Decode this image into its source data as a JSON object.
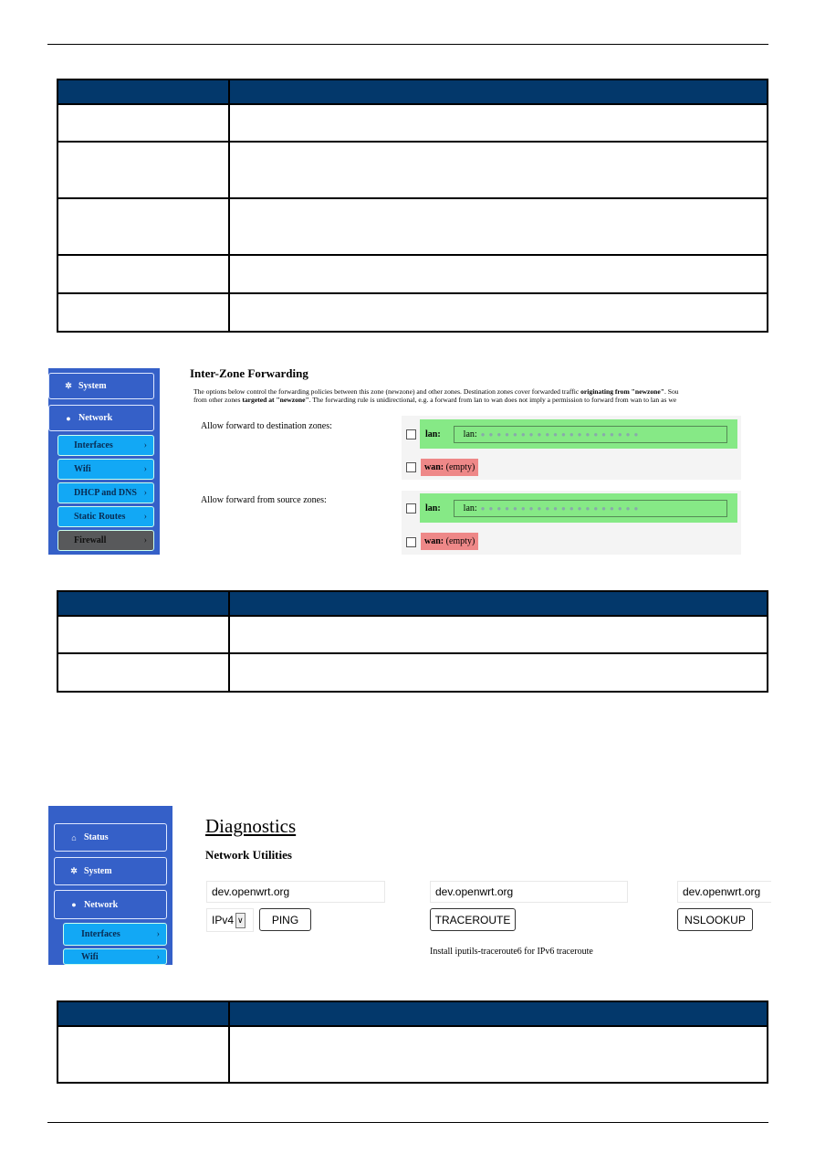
{
  "colors": {
    "table_header": "#03386b",
    "sidebar": "#3560c8",
    "sub_item": "#12a8f5",
    "active_item": "#58595b",
    "zone_lan": "#86e986",
    "zone_wan": "#ee8888"
  },
  "table1": {
    "rows": 5
  },
  "table2": {
    "rows": 2
  },
  "table3": {
    "rows": 1
  },
  "shot1": {
    "sidebar": [
      {
        "label": "System",
        "icon": "gear-icon"
      },
      {
        "label": "Network",
        "icon": "globe-icon"
      }
    ],
    "subitems": [
      "Interfaces",
      "Wifi",
      "DHCP and DNS",
      "Static Routes",
      "Firewall"
    ],
    "chevron": "›",
    "title": "Inter-Zone Forwarding",
    "desc1_a": "The options below control the forwarding policies between this zone (newzone) and other zones. Destination zones cover forwarded traffic ",
    "desc1_b": "originating from \"newzone\"",
    "desc1_c": ". Sou",
    "desc2_a": "from other zones ",
    "desc2_b": "targeted at \"newzone\"",
    "desc2_c": ". The forwarding rule is unidirectional, e.g. a forward from lan to wan does not imply a permission to forward from wan to lan as we",
    "dest_label": "Allow forward to destination zones:",
    "src_label": "Allow forward from source zones:",
    "lan_name": "lan:",
    "lan_inner": "lan:",
    "wan_name": "wan:",
    "wan_value": "(empty)"
  },
  "shot2": {
    "sidebar": [
      {
        "label": "Status",
        "icon": "home-icon"
      },
      {
        "label": "System",
        "icon": "gear-icon"
      },
      {
        "label": "Network",
        "icon": "globe-icon"
      }
    ],
    "subitems": [
      "Interfaces",
      "Wifi"
    ],
    "chevron": "›",
    "title": "Diagnostics",
    "subtitle": "Network Utilities",
    "ping_host": "dev.openwrt.org",
    "trace_host": "dev.openwrt.org",
    "nslookup_host": "dev.openwrt.org",
    "ip_version": "IPv4",
    "ping_label": "PING",
    "traceroute_label": "TRACEROUTE",
    "nslookup_label": "NSLOOKUP",
    "note": "Install iputils-traceroute6 for IPv6 traceroute"
  }
}
